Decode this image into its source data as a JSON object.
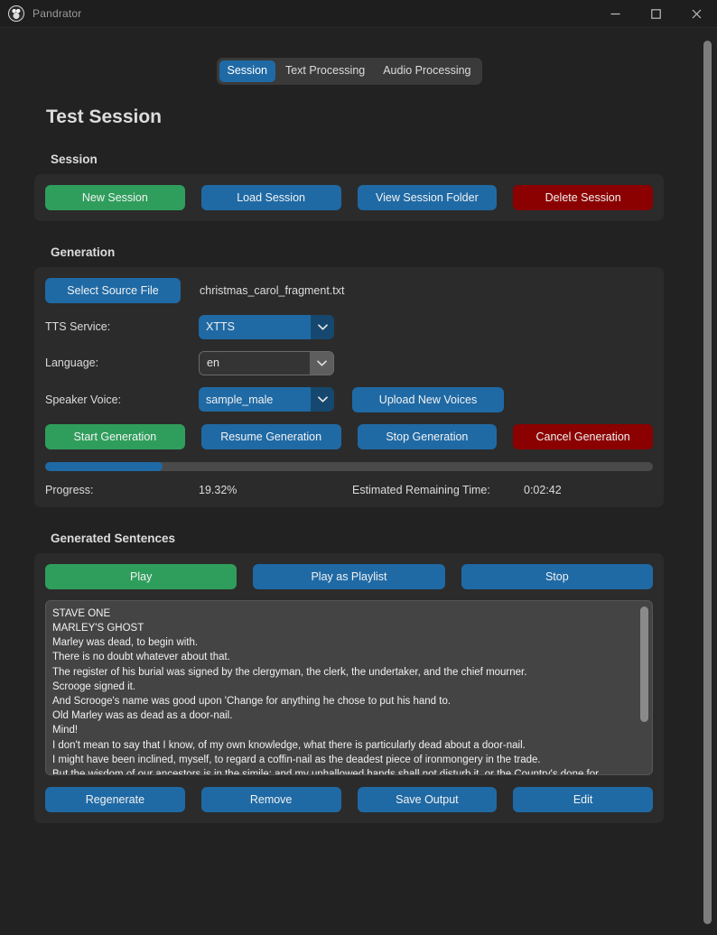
{
  "window": {
    "app_title": "Pandrator",
    "icon": "app-logo-icon",
    "controls": {
      "minimize": "minimize-icon",
      "maximize": "maximize-icon",
      "close": "close-icon"
    }
  },
  "tabs": [
    {
      "label": "Session",
      "active": true
    },
    {
      "label": "Text Processing",
      "active": false
    },
    {
      "label": "Audio Processing",
      "active": false
    }
  ],
  "page_title": "Test Session",
  "sections": {
    "session": {
      "label": "Session",
      "buttons": [
        {
          "label": "New Session",
          "color": "green"
        },
        {
          "label": "Load Session",
          "color": "blue"
        },
        {
          "label": "View Session Folder",
          "color": "blue"
        },
        {
          "label": "Delete Session",
          "color": "red"
        }
      ]
    },
    "generation": {
      "label": "Generation",
      "select_source_file_button": "Select Source File",
      "source_file_name": "christmas_carol_fragment.txt",
      "tts_service": {
        "label": "TTS Service:",
        "value": "XTTS"
      },
      "language": {
        "label": "Language:",
        "value": "en"
      },
      "speaker_voice": {
        "label": "Speaker Voice:",
        "value": "sample_male"
      },
      "upload_voices_button": "Upload New Voices",
      "action_buttons": [
        {
          "label": "Start Generation",
          "color": "green"
        },
        {
          "label": "Resume Generation",
          "color": "blue"
        },
        {
          "label": "Stop Generation",
          "color": "blue"
        },
        {
          "label": "Cancel Generation",
          "color": "red"
        }
      ],
      "progress": {
        "label": "Progress:",
        "value": "19.32%",
        "percent": 19.32,
        "eta_label": "Estimated Remaining Time:",
        "eta_value": "0:02:42"
      }
    },
    "generated_sentences": {
      "label": "Generated Sentences",
      "playback_buttons": [
        {
          "label": "Play",
          "color": "green"
        },
        {
          "label": "Play as Playlist",
          "color": "blue"
        },
        {
          "label": "Stop",
          "color": "blue"
        }
      ],
      "lines": [
        "STAVE ONE",
        "MARLEY'S GHOST",
        "Marley was dead, to begin with.",
        "There is no doubt whatever about that.",
        "The register of his burial was signed by the clergyman, the clerk, the undertaker, and the chief mourner.",
        "Scrooge signed it.",
        "And Scrooge's name was good upon 'Change for anything he chose to put his hand to.",
        "Old Marley was as dead as a door-nail.",
        "Mind!",
        "I don't mean to say that I know, of my own knowledge, what there is particularly dead about a door-nail.",
        "I might have been inclined, myself, to regard a coffin-nail as the deadest piece of ironmongery in the trade.",
        "But the wisdom of our ancestors is in the simile; and my unhallowed hands shall not disturb it, or the Country's done for."
      ],
      "bottom_buttons": [
        {
          "label": "Regenerate",
          "color": "blue"
        },
        {
          "label": "Remove",
          "color": "blue"
        },
        {
          "label": "Save Output",
          "color": "blue"
        },
        {
          "label": "Edit",
          "color": "blue"
        }
      ]
    }
  },
  "colors": {
    "accent_blue": "#1f6aa5",
    "success_green": "#2f9e5c",
    "danger_red": "#8b0000",
    "panel_bg": "#2b2b2b",
    "page_bg": "#222222",
    "listbox_bg": "#444444"
  }
}
